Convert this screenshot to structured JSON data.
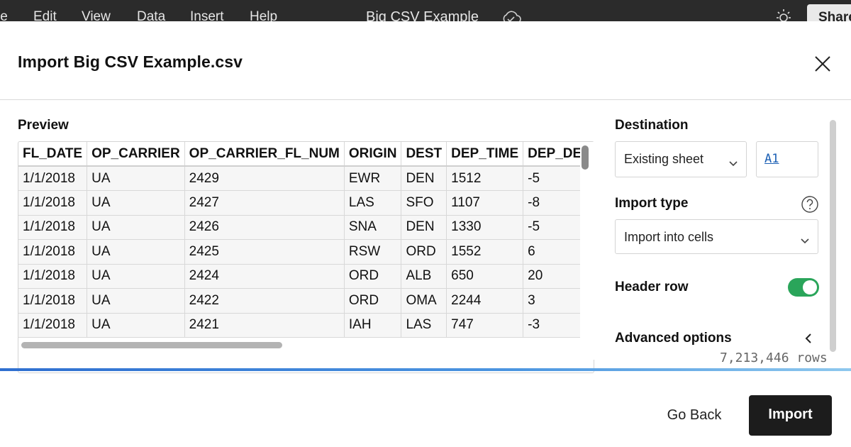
{
  "appbar": {
    "menu": [
      "le",
      "Edit",
      "View",
      "Data",
      "Insert",
      "Help"
    ],
    "doc_title": "Big CSV Example",
    "share_label": "Share"
  },
  "dialog": {
    "title": "Import Big CSV Example.csv"
  },
  "preview": {
    "label": "Preview",
    "columns": [
      "FL_DATE",
      "OP_CARRIER",
      "OP_CARRIER_FL_NUM",
      "ORIGIN",
      "DEST",
      "DEP_TIME",
      "DEP_DELAY"
    ],
    "rows": [
      [
        "1/1/2018",
        "UA",
        "2429",
        "EWR",
        "DEN",
        "1512",
        "-5"
      ],
      [
        "1/1/2018",
        "UA",
        "2427",
        "LAS",
        "SFO",
        "1107",
        "-8"
      ],
      [
        "1/1/2018",
        "UA",
        "2426",
        "SNA",
        "DEN",
        "1330",
        "-5"
      ],
      [
        "1/1/2018",
        "UA",
        "2425",
        "RSW",
        "ORD",
        "1552",
        "6"
      ],
      [
        "1/1/2018",
        "UA",
        "2424",
        "ORD",
        "ALB",
        "650",
        "20"
      ],
      [
        "1/1/2018",
        "UA",
        "2422",
        "ORD",
        "OMA",
        "2244",
        "3"
      ],
      [
        "1/1/2018",
        "UA",
        "2421",
        "IAH",
        "LAS",
        "747",
        "-3"
      ]
    ]
  },
  "options": {
    "destination_label": "Destination",
    "destination_value": "Existing sheet",
    "cell_ref": "A1",
    "import_type_label": "Import type",
    "import_type_value": "Import into cells",
    "header_row_label": "Header row",
    "header_row_enabled": true,
    "advanced_label": "Advanced options",
    "row_count": "7,213,446 rows"
  },
  "footer": {
    "go_back_label": "Go Back",
    "import_label": "Import"
  },
  "colors": {
    "toggle_on": "#2aa55a",
    "primary_button": "#1c1c1c",
    "link": "#1a5fb4"
  }
}
